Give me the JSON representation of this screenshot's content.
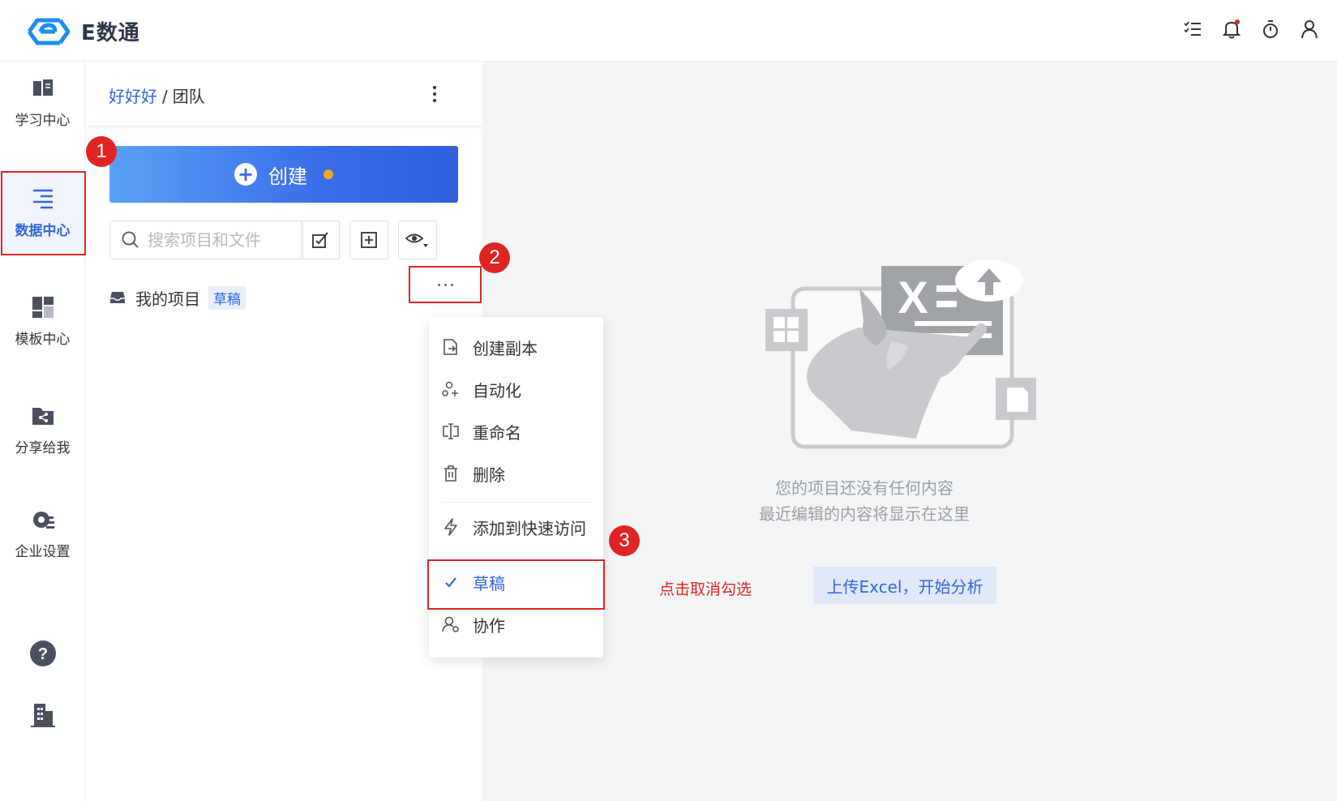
{
  "app": {
    "name": "E数通"
  },
  "colors": {
    "primary": "#3165e0",
    "annotation": "#e02424",
    "accent_dot": "#f5a623"
  },
  "header_icons": [
    "task-list-icon",
    "bell-icon",
    "timer-icon",
    "user-icon"
  ],
  "nav": {
    "items": [
      {
        "label": "学习中心",
        "icon": "book-icon"
      },
      {
        "label": "数据中心",
        "icon": "data-list-icon",
        "active": true
      },
      {
        "label": "模板中心",
        "icon": "template-icon"
      },
      {
        "label": "分享给我",
        "icon": "shared-folder-icon"
      },
      {
        "label": "企业设置",
        "icon": "settings-gear-icon"
      }
    ],
    "bottom_icons": [
      "help-icon",
      "building-icon"
    ]
  },
  "panel": {
    "breadcrumb": {
      "link": "好好好",
      "separator": "/",
      "current": "团队"
    },
    "create_label": "创建",
    "search_placeholder": "搜索项目和文件",
    "project": {
      "name": "我的项目",
      "tag": "草稿"
    }
  },
  "menu": {
    "items": [
      {
        "label": "创建副本",
        "icon": "copy-icon"
      },
      {
        "label": "自动化",
        "icon": "automation-icon"
      },
      {
        "label": "重命名",
        "icon": "rename-icon"
      },
      {
        "label": "删除",
        "icon": "trash-icon"
      },
      {
        "label": "添加到快速访问",
        "icon": "lightning-icon"
      },
      {
        "label": "草稿",
        "icon": "check-icon",
        "checked": true
      },
      {
        "label": "协作",
        "icon": "collaborate-icon"
      }
    ]
  },
  "empty_state": {
    "line1": "您的项目还没有任何内容",
    "line2": "最近编辑的内容将显示在这里",
    "upload_label": "上传Excel，开始分析",
    "illustration_text": "X"
  },
  "annotations": {
    "step1": "1",
    "step2": "2",
    "step3": "3",
    "hint": "点击取消勾选"
  }
}
